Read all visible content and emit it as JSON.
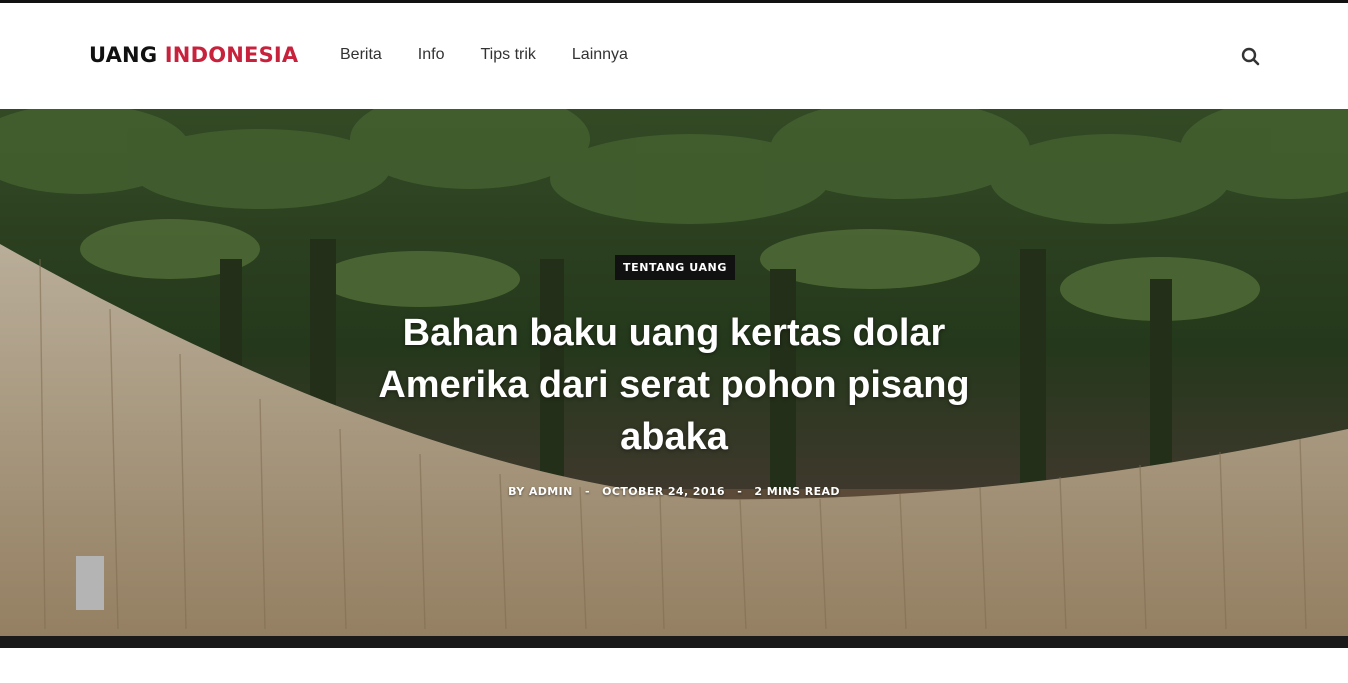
{
  "header": {
    "logo_part1": "UANG",
    "logo_part2": "INDONESIA",
    "nav": [
      "Berita",
      "Info",
      "Tips trik",
      "Lainnya"
    ],
    "search_icon": "search-icon"
  },
  "hero": {
    "category": "TENTANG UANG",
    "title": "Bahan baku uang kertas dolar Amerika dari serat pohon pisang abaka",
    "author": "BY ADMIN",
    "date": "OCTOBER 24, 2016",
    "read_time": "2 MINS READ",
    "separator": "-"
  },
  "colors": {
    "accent": "#c8213c",
    "text": "#111111",
    "nav_text": "#333333",
    "badge_bg": "#111111"
  }
}
